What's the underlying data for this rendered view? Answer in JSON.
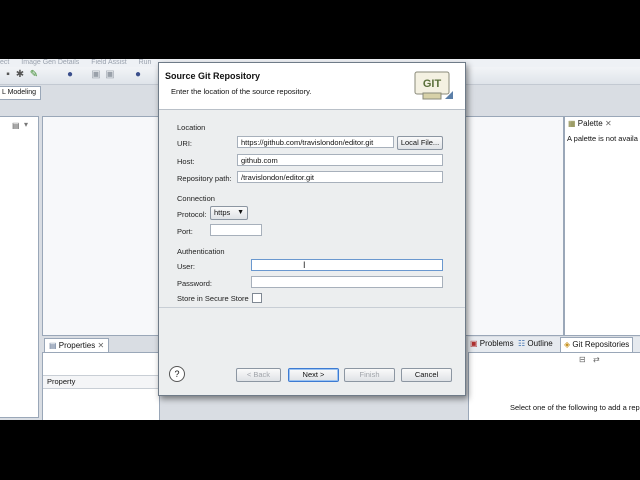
{
  "menubar": {
    "items": [
      "ect",
      "Image Gen Details",
      "Field Assist",
      "Run"
    ]
  },
  "toolbar": {
    "icons": [
      "new-icon",
      "gear-icon",
      "run-icon",
      "globe-icon",
      "save-icon",
      "save-all-icon",
      "debug-icon"
    ]
  },
  "perspective": {
    "label": "L Modeling"
  },
  "palette": {
    "tab_label": "Palette",
    "message": "A palette is not availa"
  },
  "properties": {
    "tab_label": "Properties",
    "column": "Property"
  },
  "bottom_tabs": {
    "problems": "Problems",
    "outline": "Outline",
    "git_repos": "Git Repositories",
    "message": "Select one of the following to add a rep"
  },
  "dialog": {
    "title": "Source Git Repository",
    "description": "Enter the location of the source repository.",
    "logo_text": "GIT",
    "location": {
      "group_label": "Location",
      "uri_label": "URI:",
      "uri_value": "https://github.com/travislondon/editor.git",
      "local_file_button": "Local File...",
      "host_label": "Host:",
      "host_value": "github.com",
      "repo_path_label": "Repository path:",
      "repo_path_value": "/travislondon/editor.git"
    },
    "connection": {
      "group_label": "Connection",
      "protocol_label": "Protocol:",
      "protocol_value": "https",
      "port_label": "Port:",
      "port_value": ""
    },
    "authentication": {
      "group_label": "Authentication",
      "user_label": "User:",
      "user_value": "",
      "password_label": "Password:",
      "password_value": "",
      "store_label": "Store in Secure Store"
    },
    "buttons": {
      "back": "< Back",
      "next": "Next >",
      "finish": "Finish",
      "cancel": "Cancel",
      "help": "?"
    }
  }
}
